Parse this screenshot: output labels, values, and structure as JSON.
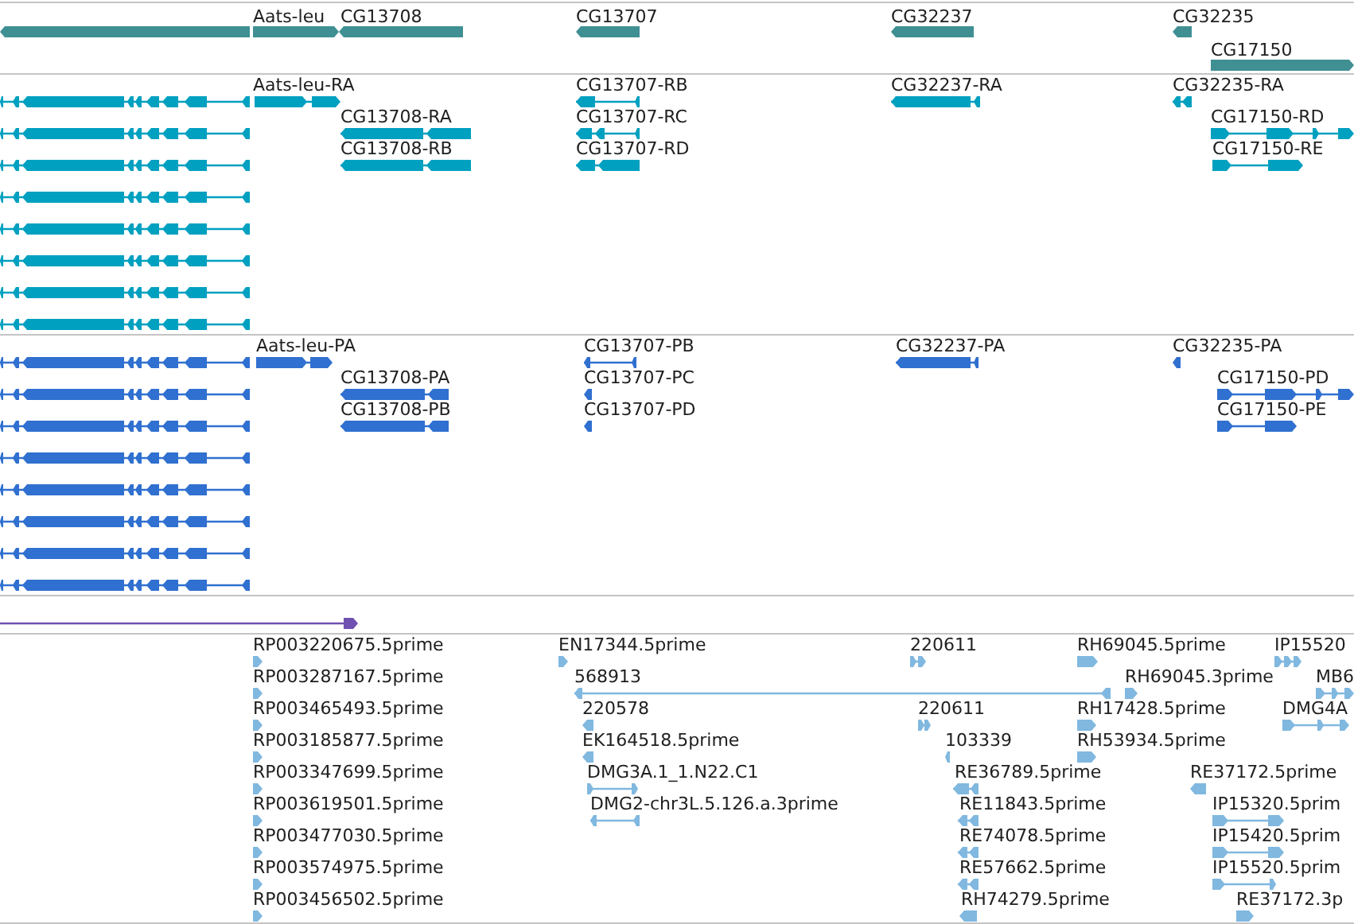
{
  "tracks": [
    {
      "kind": "gene",
      "color": "#3f8f93",
      "features": [
        {
          "reverse": true
        },
        {
          "label": "Aats-leu",
          "reverse": false
        },
        {
          "label": "CG13708",
          "reverse": true
        },
        {
          "label": "CG13707",
          "reverse": true
        },
        {
          "label": "CG32237",
          "reverse": true
        },
        {
          "label": "CG32235",
          "reverse": true
        },
        {
          "label": "CG17150",
          "reverse": false
        }
      ]
    },
    {
      "kind": "transcript",
      "color": "#00a0c0",
      "features": [
        {
          "reverse": true
        },
        {
          "label": "Aats-leu-RA",
          "reverse": false
        },
        {
          "label": "CG13707-RB",
          "reverse": true
        },
        {
          "label": "CG32237-RA",
          "reverse": true
        },
        {
          "label": "CG32235-RA",
          "reverse": true
        },
        {
          "reverse": true
        },
        {
          "label": "CG13708-RA",
          "reverse": true
        },
        {
          "label": "CG13707-RC",
          "reverse": true
        },
        {
          "label": "CG17150-RD",
          "reverse": false
        },
        {
          "reverse": true
        },
        {
          "label": "CG13708-RB",
          "reverse": true
        },
        {
          "label": "CG13707-RD",
          "reverse": true
        },
        {
          "label": "CG17150-RE",
          "reverse": false
        },
        {
          "reverse": true
        },
        {
          "reverse": true
        },
        {
          "reverse": true
        },
        {
          "reverse": true
        },
        {
          "reverse": true
        }
      ]
    },
    {
      "kind": "protein",
      "color": "#3070d0",
      "features": [
        {
          "reverse": true
        },
        {
          "label": "Aats-leu-PA",
          "reverse": false
        },
        {
          "label": "CG13707-PB",
          "reverse": true
        },
        {
          "label": "CG32237-PA",
          "reverse": true
        },
        {
          "label": "CG32235-PA",
          "reverse": true
        },
        {
          "reverse": true
        },
        {
          "label": "CG13708-PA",
          "reverse": true
        },
        {
          "label": "CG13707-PC",
          "reverse": true
        },
        {
          "label": "CG17150-PD",
          "reverse": false
        },
        {
          "reverse": true
        },
        {
          "label": "CG13708-PB",
          "reverse": true
        },
        {
          "label": "CG13707-PD",
          "reverse": true
        },
        {
          "label": "CG17150-PE",
          "reverse": false
        },
        {
          "reverse": true
        },
        {
          "reverse": true
        },
        {
          "reverse": true
        },
        {
          "reverse": true
        },
        {
          "reverse": true
        }
      ]
    },
    {
      "kind": "contig",
      "color": "#7050b0",
      "features": [
        {
          "reverse": false
        }
      ]
    },
    {
      "kind": "est",
      "color": "#80b8e0",
      "features": [
        {
          "label": "RP003220675.5prime",
          "reverse": false
        },
        {
          "label": "EN17344.5prime",
          "reverse": false
        },
        {
          "label": "220611",
          "reverse": false
        },
        {
          "label": "RH69045.5prime",
          "reverse": false
        },
        {
          "label": "IP15520",
          "reverse": false
        },
        {
          "label": "RP003287167.5prime",
          "reverse": false
        },
        {
          "label": "568913",
          "reverse": true
        },
        {
          "label": "RH69045.3prime",
          "reverse": false
        },
        {
          "label": "MB6",
          "reverse": false
        },
        {
          "label": "RP003465493.5prime",
          "reverse": false
        },
        {
          "label": "220578",
          "reverse": true
        },
        {
          "label": "220611",
          "reverse": false
        },
        {
          "label": "RH17428.5prime",
          "reverse": false
        },
        {
          "label": "DMG4A",
          "reverse": false
        },
        {
          "label": "RP003185877.5prime",
          "reverse": false
        },
        {
          "label": "EK164518.5prime",
          "reverse": true
        },
        {
          "label": "103339",
          "reverse": true
        },
        {
          "label": "RH53934.5prime",
          "reverse": false
        },
        {
          "label": "RP003347699.5prime",
          "reverse": false
        },
        {
          "label": "DMG3A.1_1.N22.C1",
          "reverse": false
        },
        {
          "label": "RE36789.5prime",
          "reverse": true
        },
        {
          "label": "RE37172.5prime",
          "reverse": true
        },
        {
          "label": "RP003619501.5prime",
          "reverse": false
        },
        {
          "label": "DMG2-chr3L.5.126.a.3prime",
          "reverse": true
        },
        {
          "label": "RE11843.5prime",
          "reverse": true
        },
        {
          "label": "IP15320.5prim",
          "reverse": false
        },
        {
          "label": "RP003477030.5prime",
          "reverse": false
        },
        {
          "label": "RE74078.5prime",
          "reverse": true
        },
        {
          "label": "IP15420.5prim",
          "reverse": false
        },
        {
          "label": "RP003574975.5prime",
          "reverse": false
        },
        {
          "label": "RE57662.5prime",
          "reverse": true
        },
        {
          "label": "IP15520.5prim",
          "reverse": false
        },
        {
          "label": "RP003456502.5prime",
          "reverse": false
        },
        {
          "label": "RH74279.5prime",
          "reverse": true
        },
        {
          "label": "RE37172.3p",
          "reverse": false
        }
      ]
    }
  ]
}
